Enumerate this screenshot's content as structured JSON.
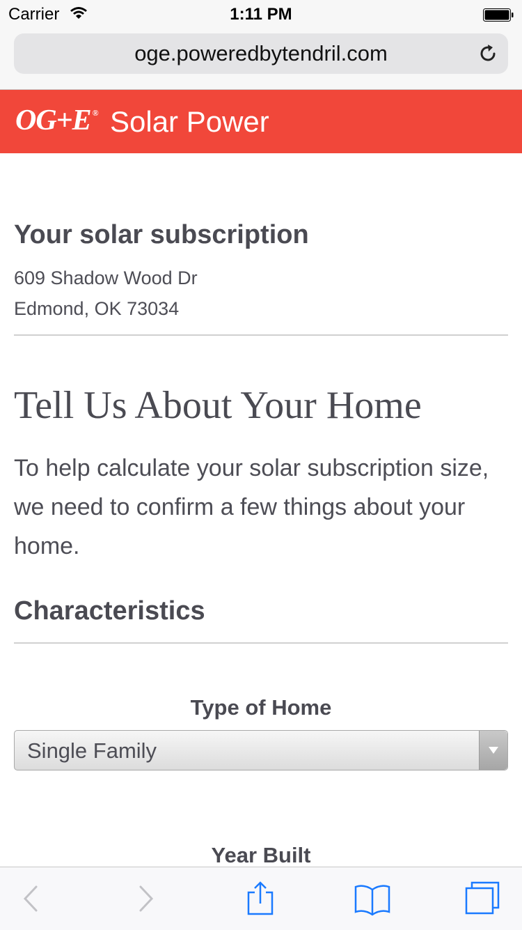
{
  "status_bar": {
    "carrier": "Carrier",
    "time": "1:11 PM"
  },
  "browser": {
    "url": "oge.poweredbytendril.com"
  },
  "header": {
    "logo_text": "OG+E",
    "logo_mark": "®",
    "title": "Solar Power",
    "color": "#f1473a"
  },
  "subscription": {
    "title": "Your solar subscription",
    "address_line1": "609 Shadow Wood Dr",
    "address_line2": "Edmond, OK 73034"
  },
  "intro": {
    "heading": "Tell Us About Your Home",
    "text": "To help calculate your solar subscription size, we need to confirm a few things about your home."
  },
  "characteristics": {
    "heading": "Characteristics",
    "type_label": "Type of Home",
    "type_value": "Single Family",
    "year_label": "Year Built"
  },
  "toolbar": {
    "icons": [
      "back-icon",
      "forward-icon",
      "share-icon",
      "bookmarks-icon",
      "tabs-icon"
    ],
    "accent": "#1a7aff"
  }
}
